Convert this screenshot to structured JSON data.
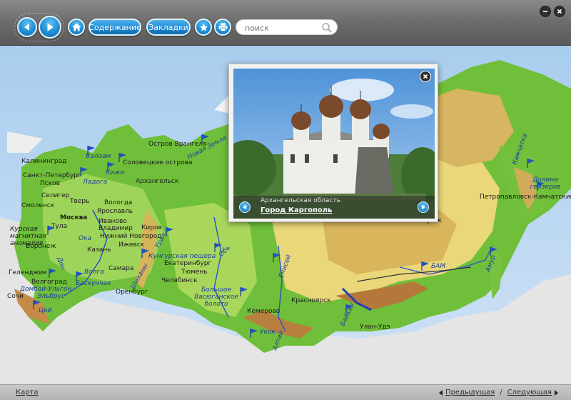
{
  "toolbar": {
    "back_icon": "arrow-left-icon",
    "forward_icon": "arrow-right-icon",
    "home_icon": "home-icon",
    "contents_label": "Содержание",
    "bookmarks_label": "Закладки",
    "star_icon": "star-icon",
    "print_icon": "printer-icon",
    "search_placeholder": "поиск",
    "minimize_icon": "minimize-icon",
    "close_icon": "close-icon",
    "accent": "#1f8fd6"
  },
  "popup": {
    "region": "Архангельская область",
    "city": "Город Каргополь",
    "prev_icon": "arrow-left-icon",
    "next_icon": "arrow-right-icon",
    "close_icon": "close-icon"
  },
  "map": {
    "labels": {
      "kaliningrad": "Калининград",
      "spb": "Санкт-Петербург",
      "pskov": "Псков",
      "valaam": "Валаам",
      "kizhi": "Кижи",
      "ladoga": "Ладога",
      "solovki": "Соловецкие острова",
      "arkhangelsk": "Архангельск",
      "wrangel": "Остров Врангеля",
      "novaya_zemlya": "Новая Земля",
      "seliger": "Селигер",
      "tver": "Тверь",
      "smolensk": "Смоленск",
      "vologda": "Вологда",
      "yaroslavl": "Ярославль",
      "moscow": "Москва",
      "ivanovo": "Иваново",
      "vladimir": "Владимир",
      "tula": "Тула",
      "kursk_anomaly": "Курская магнитная аномалия",
      "nizhny": "Нижний Новгород",
      "kirov": "Киров",
      "oka": "Ока",
      "voronezh": "Воронеж",
      "kazan": "Казань",
      "izhevsk": "Ижевск",
      "kungur": "Кунгурская пещера",
      "ural": "Урал",
      "ob": "Обь",
      "yenisei": "Енисей",
      "ekaterinburg": "Екатеринбург",
      "tyumen": "Тюмень",
      "samara": "Самара",
      "volga": "Волга",
      "don": "Дон",
      "gelendzhik": "Геленджик",
      "volgograd": "Волгоград",
      "baskunchak": "Баскунчак",
      "shikhany": "Шиханы",
      "chelyabinsk": "Челябинск",
      "dombai": "Домбай-Ульген",
      "sochi": "Сочи",
      "elbrus": "Эльбрус",
      "tsey": "Цей",
      "orenburg": "Оренбург",
      "vasyugan": "Большое Васюганское болото",
      "kemerovo": "Кемерово",
      "krasnoyarsk": "Красноярск",
      "ukok": "Укок",
      "altai": "Алтай",
      "baikal": "Байкал",
      "ulan_ude": "Улан-Удэ",
      "bam": "БАМ",
      "amur": "Амур",
      "kamchatka": "Камчатка",
      "geysers": "Долина гейзеров",
      "petropavlovsk": "Петропавловск-Камчатский",
      "yakutsk": "Якутск"
    }
  },
  "footer": {
    "breadcrumb": "Карта",
    "prev_label": "Предыдущая",
    "separator": "/",
    "next_label": "Следующая"
  }
}
